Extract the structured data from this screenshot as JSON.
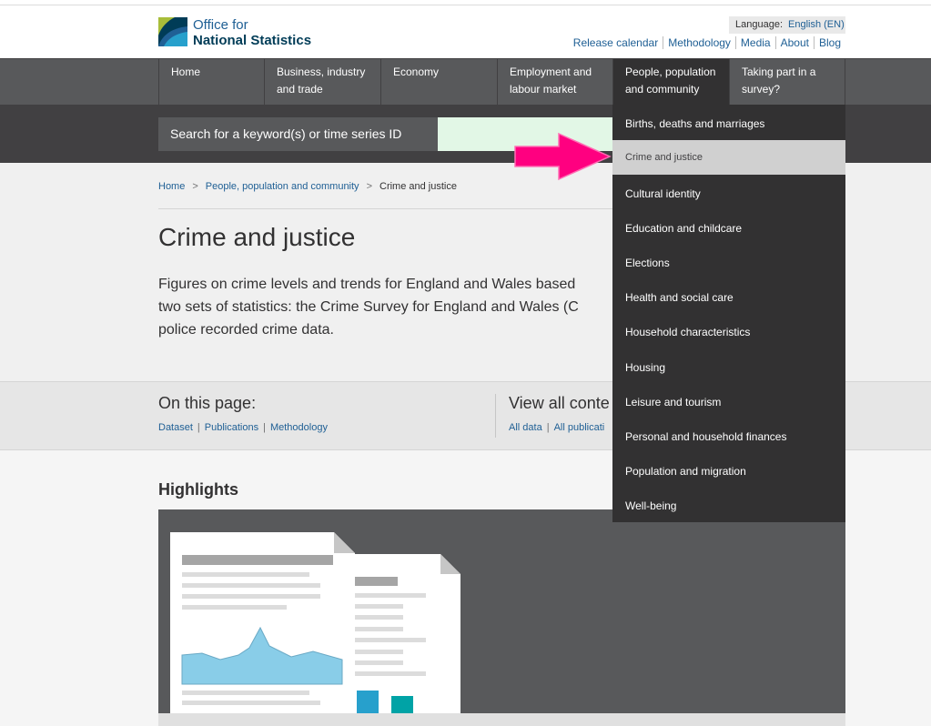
{
  "header": {
    "logo_line1": "Office for",
    "logo_line2": "National Statistics",
    "language_label": "Language:",
    "language_value": "English (EN)",
    "top_links": [
      "Release calendar",
      "Methodology",
      "Media",
      "About",
      "Blog"
    ]
  },
  "nav": {
    "items": [
      {
        "label": "Home"
      },
      {
        "label": "Business, industry and trade"
      },
      {
        "label": "Economy"
      },
      {
        "label": "Employment and labour market"
      },
      {
        "label": "People, population and community"
      },
      {
        "label": "Taking part in a survey?"
      }
    ]
  },
  "search": {
    "placeholder": "Search for a keyword(s) or time series ID"
  },
  "breadcrumb": {
    "items": [
      "Home",
      "People, population and community",
      "Crime and justice"
    ],
    "separator": ">"
  },
  "page": {
    "title": "Crime and justice",
    "summary_lines": [
      "Figures on crime levels and trends for England and Wales based",
      "two sets of statistics: the Crime Survey for England and Wales (C",
      "police recorded crime data."
    ]
  },
  "on_this_page": {
    "heading": "On this page:",
    "links": [
      "Dataset",
      "Publications",
      "Methodology"
    ]
  },
  "view_all": {
    "heading": "View all conte",
    "links": [
      "All data",
      "All publicati"
    ]
  },
  "highlights": {
    "title": "Highlights"
  },
  "dropdown": {
    "items": [
      "Births, deaths and marriages",
      "Crime and justice",
      "Cultural identity",
      "Education and childcare",
      "Elections",
      "Health and social care",
      "Household characteristics",
      "Housing",
      "Leisure and tourism",
      "Personal and household finances",
      "Population and migration",
      "Well-being"
    ],
    "selected_index": 1
  },
  "colors": {
    "brand_blue": "#206095",
    "nav_bg": "#58595b",
    "nav_active": "#323132",
    "annotation_arrow": "#ff0080",
    "search_highlight": "#e2f7e6"
  }
}
